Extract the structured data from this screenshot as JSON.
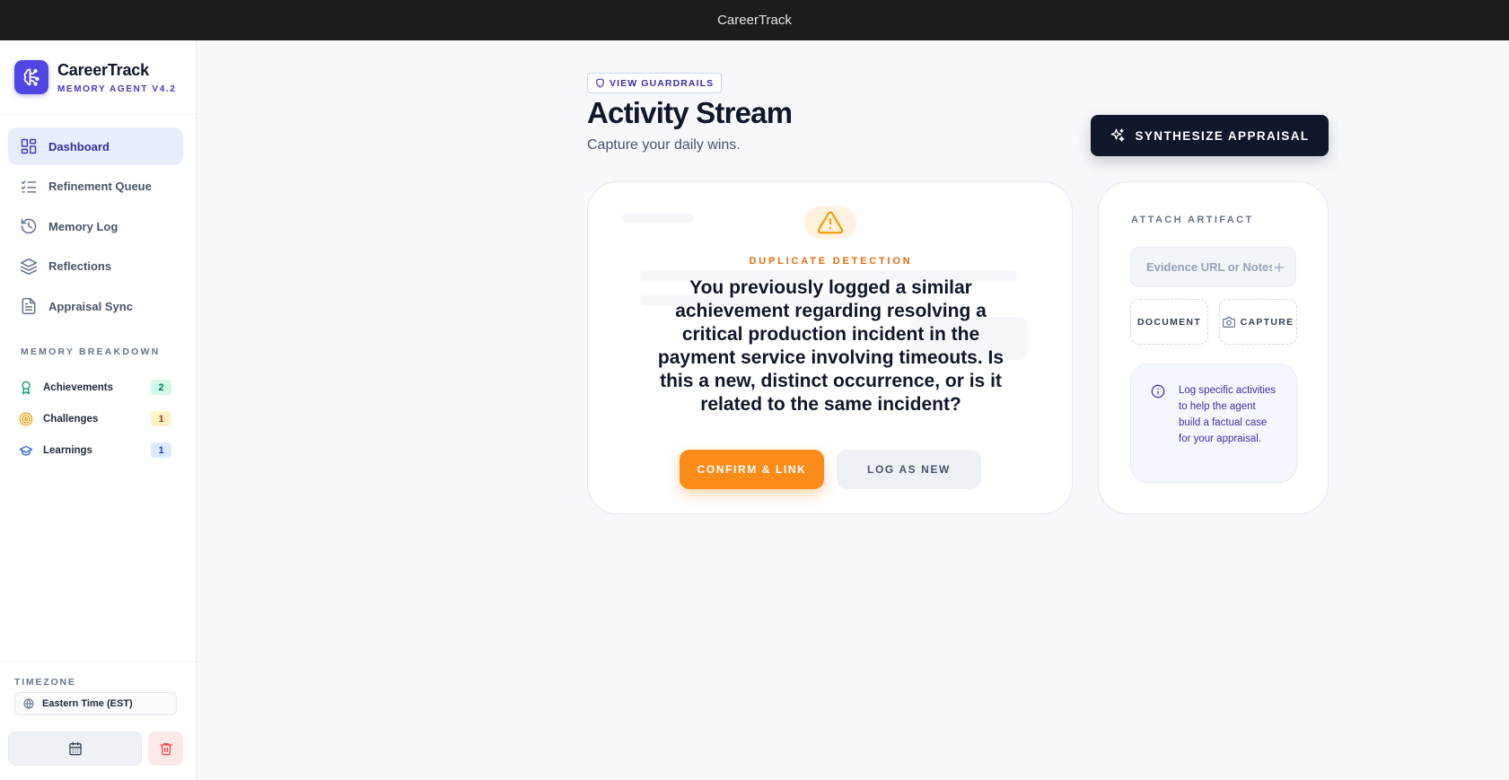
{
  "window": {
    "title": "CareerTrack"
  },
  "brand": {
    "name": "CareerTrack",
    "subtitle": "MEMORY AGENT V4.2"
  },
  "nav": [
    {
      "label": "Dashboard",
      "icon": "dashboard-icon",
      "active": true
    },
    {
      "label": "Refinement Queue",
      "icon": "list-checks-icon"
    },
    {
      "label": "Memory Log",
      "icon": "history-icon"
    },
    {
      "label": "Reflections",
      "icon": "layers-icon"
    },
    {
      "label": "Appraisal Sync",
      "icon": "document-icon"
    }
  ],
  "breakdown": {
    "title": "MEMORY BREAKDOWN",
    "items": [
      {
        "label": "Achievements",
        "count": "2",
        "icon": "award-icon",
        "color": "#059669"
      },
      {
        "label": "Challenges",
        "count": "1",
        "icon": "target-icon",
        "color": "#f59e0b"
      },
      {
        "label": "Learnings",
        "count": "1",
        "icon": "graduation-cap-icon",
        "color": "#2563eb"
      }
    ]
  },
  "timezone": {
    "label": "TIMEZONE",
    "value": "Eastern Time (EST)"
  },
  "header": {
    "guardrails": "VIEW GUARDRAILS",
    "title": "Activity Stream",
    "subtitle": "Capture your daily wins.",
    "synthesize": "SYNTHESIZE APPRAISAL"
  },
  "duplicate": {
    "label": "DUPLICATE DETECTION",
    "message": "You previously logged a similar achievement regarding resolving a critical production incident in the payment service involving timeouts. Is this a new, distinct occurrence, or is it related to the same incident?",
    "confirm": "CONFIRM & LINK",
    "log_new": "LOG AS NEW"
  },
  "artifact": {
    "label": "ATTACH ARTIFACT",
    "placeholder": "Evidence URL or Notes",
    "document": "DOCUMENT",
    "capture": "CAPTURE",
    "info": "Log specific activities to help the agent build a factual case for your appraisal."
  },
  "colors": {
    "accent": "#4f46e5",
    "warning": "#fb8c1a",
    "dark": "#0f172a"
  }
}
